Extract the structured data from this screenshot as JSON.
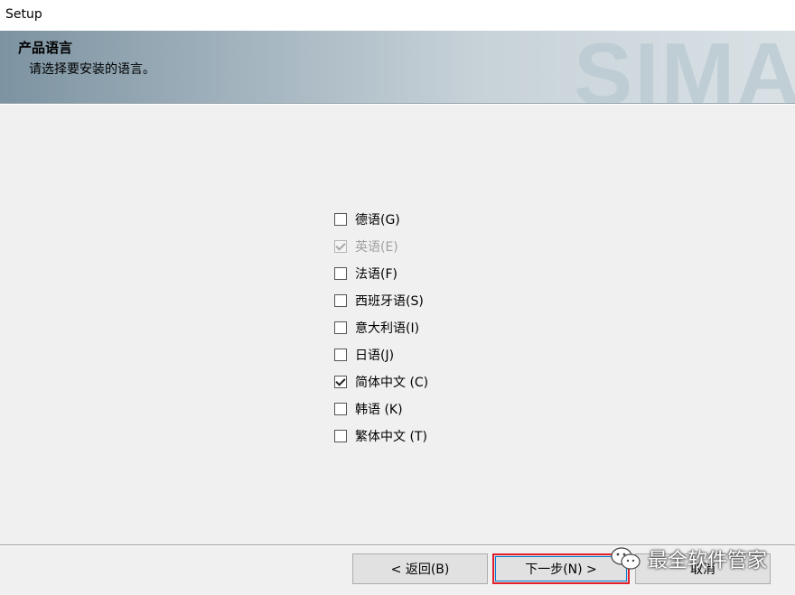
{
  "window": {
    "title": "Setup"
  },
  "banner": {
    "heading": "产品语言",
    "subheading": "请选择要安装的语言。",
    "watermark": "SIMA"
  },
  "languages": [
    {
      "label": "德语(G)",
      "checked": false,
      "disabled": false
    },
    {
      "label": "英语(E)",
      "checked": true,
      "disabled": true
    },
    {
      "label": "法语(F)",
      "checked": false,
      "disabled": false
    },
    {
      "label": "西班牙语(S)",
      "checked": false,
      "disabled": false
    },
    {
      "label": "意大利语(I)",
      "checked": false,
      "disabled": false
    },
    {
      "label": "日语(J)",
      "checked": false,
      "disabled": false
    },
    {
      "label": "简体中文 (C)",
      "checked": true,
      "disabled": false
    },
    {
      "label": "韩语 (K)",
      "checked": false,
      "disabled": false
    },
    {
      "label": "繁体中文 (T)",
      "checked": false,
      "disabled": false
    }
  ],
  "buttons": {
    "back": "< 返回(B)",
    "next": "下一步(N) >",
    "cancel": "取消"
  },
  "overlay": {
    "text": "最全软件管家",
    "icon": "wechat-logo-icon"
  }
}
